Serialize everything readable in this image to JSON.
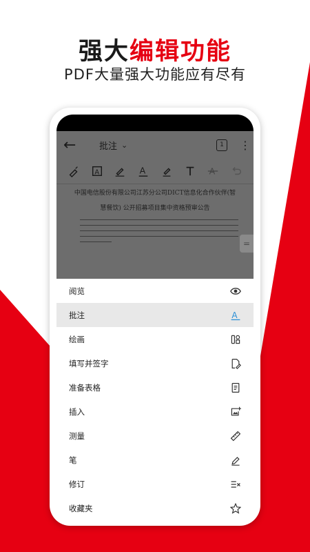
{
  "hero": {
    "title_black": "强大",
    "title_accent": "编辑功能",
    "subtitle": "PDF大量强大功能应有尽有"
  },
  "colors": {
    "accent": "#e60012",
    "active_icon": "#2a8fd6"
  },
  "appbar": {
    "title": "批注",
    "page_badge": "1"
  },
  "toolbar": {
    "tools": [
      "highlighter-pen-icon",
      "text-box-icon",
      "signature-pen-icon",
      "text-underline-icon",
      "marker-icon",
      "text-icon",
      "strikethrough-icon",
      "undo-icon"
    ]
  },
  "document": {
    "line1": "中国电信股份有限公司江苏分公司DICT信息化合作伙伴(智",
    "line2": "慧餐饮) 公开招募项目集中资格预审公告"
  },
  "menu": {
    "items": [
      {
        "label": "阅览",
        "icon": "eye-icon",
        "active": false
      },
      {
        "label": "批注",
        "icon": "annotate-a-icon",
        "active": true
      },
      {
        "label": "绘画",
        "icon": "draw-tools-icon",
        "active": false
      },
      {
        "label": "填写并签字",
        "icon": "fill-sign-icon",
        "active": false
      },
      {
        "label": "准备表格",
        "icon": "form-doc-icon",
        "active": false
      },
      {
        "label": "插入",
        "icon": "insert-image-icon",
        "active": false
      },
      {
        "label": "测量",
        "icon": "ruler-icon",
        "active": false
      },
      {
        "label": "笔",
        "icon": "pen-icon",
        "active": false
      },
      {
        "label": "修订",
        "icon": "redact-icon",
        "active": false
      },
      {
        "label": "收藏夹",
        "icon": "star-icon",
        "active": false
      }
    ]
  }
}
